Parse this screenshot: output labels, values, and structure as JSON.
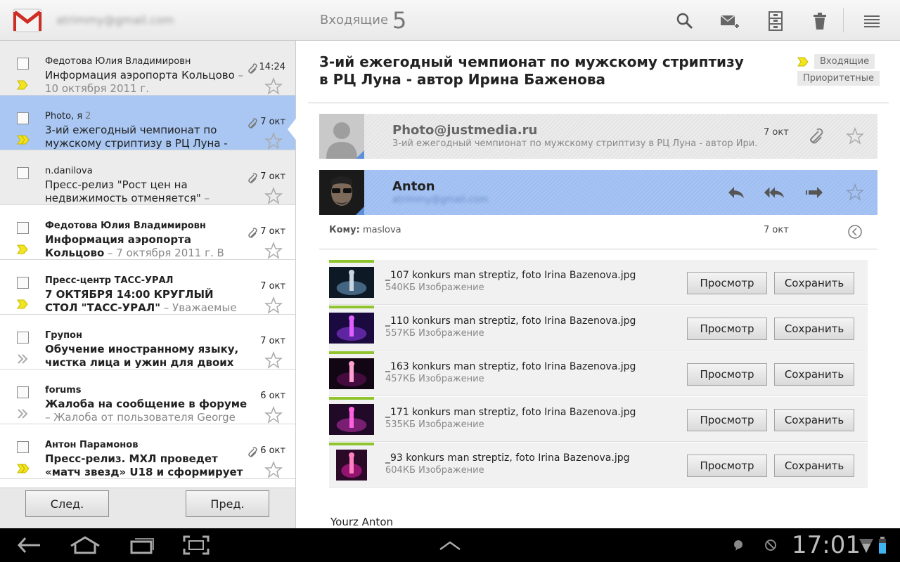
{
  "header": {
    "account": "atrimmy@gmail.com",
    "folder": "Входящие",
    "unread_count": "5"
  },
  "conversations": [
    {
      "sender": "Федотова Юлия Владимировн",
      "count": "",
      "subject": "Информация аэропорта Кольцово",
      "snippet": " – 10 октября 2011 г.",
      "time": "14:24",
      "attachment": true,
      "state": "read",
      "important": "single"
    },
    {
      "sender": "Photo, я",
      "count": "2",
      "subject": "3-ий ежегодный чемпионат по мужскому стриптизу в РЦ Луна -",
      "snippet": "",
      "time": "7 окт",
      "attachment": true,
      "state": "selected",
      "important": "double"
    },
    {
      "sender": "n.danilova",
      "count": "",
      "subject": "Пресс-релиз \"Рост цен на недвижимость отменяется\"",
      "snippet": " –",
      "time": "7 окт",
      "attachment": true,
      "state": "read",
      "important": "none"
    },
    {
      "sender": "Федотова Юлия Владимировн",
      "count": "",
      "subject": "Информация аэропорта Кольцово",
      "snippet": " – 7 октября 2011 г. В",
      "time": "7 окт",
      "attachment": true,
      "state": "unread",
      "important": "single"
    },
    {
      "sender": "Пресс-центр ТАСС-УРАЛ",
      "count": "",
      "subject": "7 ОКТЯБРЯ 14:00 КРУГЛЫЙ СТОЛ \"ТАСС-УРАЛ\"",
      "snippet": " – Уважаемые коллеги!",
      "time": "7 окт",
      "attachment": false,
      "state": "unread",
      "important": "single"
    },
    {
      "sender": "Групон",
      "count": "",
      "subject": "Обучение иностранному языку, чистка лица и ужин для двоих или",
      "snippet": "",
      "time": "7 окт",
      "attachment": false,
      "state": "unread",
      "important": "double-gray"
    },
    {
      "sender": "forums",
      "count": "",
      "subject": "Жалоба на сообщение в форуме",
      "snippet": " – Жалоба от пользователя George на",
      "time": "6 окт",
      "attachment": false,
      "state": "unread",
      "important": "double-gray"
    },
    {
      "sender": "Антон Парамонов",
      "count": "",
      "subject": "Пресс-релиз.  МХЛ проведет «матч звезд» U18 и сформирует",
      "snippet": "",
      "time": "6 окт",
      "attachment": true,
      "state": "unread",
      "important": "double"
    }
  ],
  "pager": {
    "next": "След.",
    "prev": "Пред."
  },
  "message": {
    "subject": "3-ий ежегодный чемпионат по мужскому стриптизу в РЦ Луна - автор Ирина Баженова",
    "labels": [
      "Входящие",
      "Приоритетные"
    ],
    "collapsed": {
      "from": "Photo@justmedia.ru",
      "snippet": "3-ий ежегодный чемпионат по мужскому стриптизу в РЦ Луна - автор Ири…",
      "date": "7 окт"
    },
    "open": {
      "from": "Anton",
      "email": "atrimmy@gmail.com"
    },
    "to_label": "Кому:",
    "to_value": "maslova",
    "date": "7 окт",
    "attachments": [
      {
        "name": "_107 konkurs man streptiz, foto Irina Bazenova.jpg",
        "meta": "540КБ Изображение"
      },
      {
        "name": "_110 konkurs man streptiz, foto Irina Bazenova.jpg",
        "meta": "557КБ Изображение"
      },
      {
        "name": "_163 konkurs man streptiz, foto Irina Bazenova.jpg",
        "meta": "457КБ Изображение"
      },
      {
        "name": "_171 konkurs man streptiz, foto Irina Bazenova.jpg",
        "meta": "535КБ Изображение"
      },
      {
        "name": "_93 konkurs man streptiz, foto Irina Bazenova.jpg",
        "meta": "604КБ Изображение"
      }
    ],
    "view_label": "Просмотр",
    "save_label": "Сохранить",
    "body": "Yourz Anton"
  },
  "system": {
    "time": "17:01"
  },
  "colors": {
    "accent": "#a9c7f2",
    "important": "#f2e51e",
    "attachment_bar": "#8fc42f"
  }
}
